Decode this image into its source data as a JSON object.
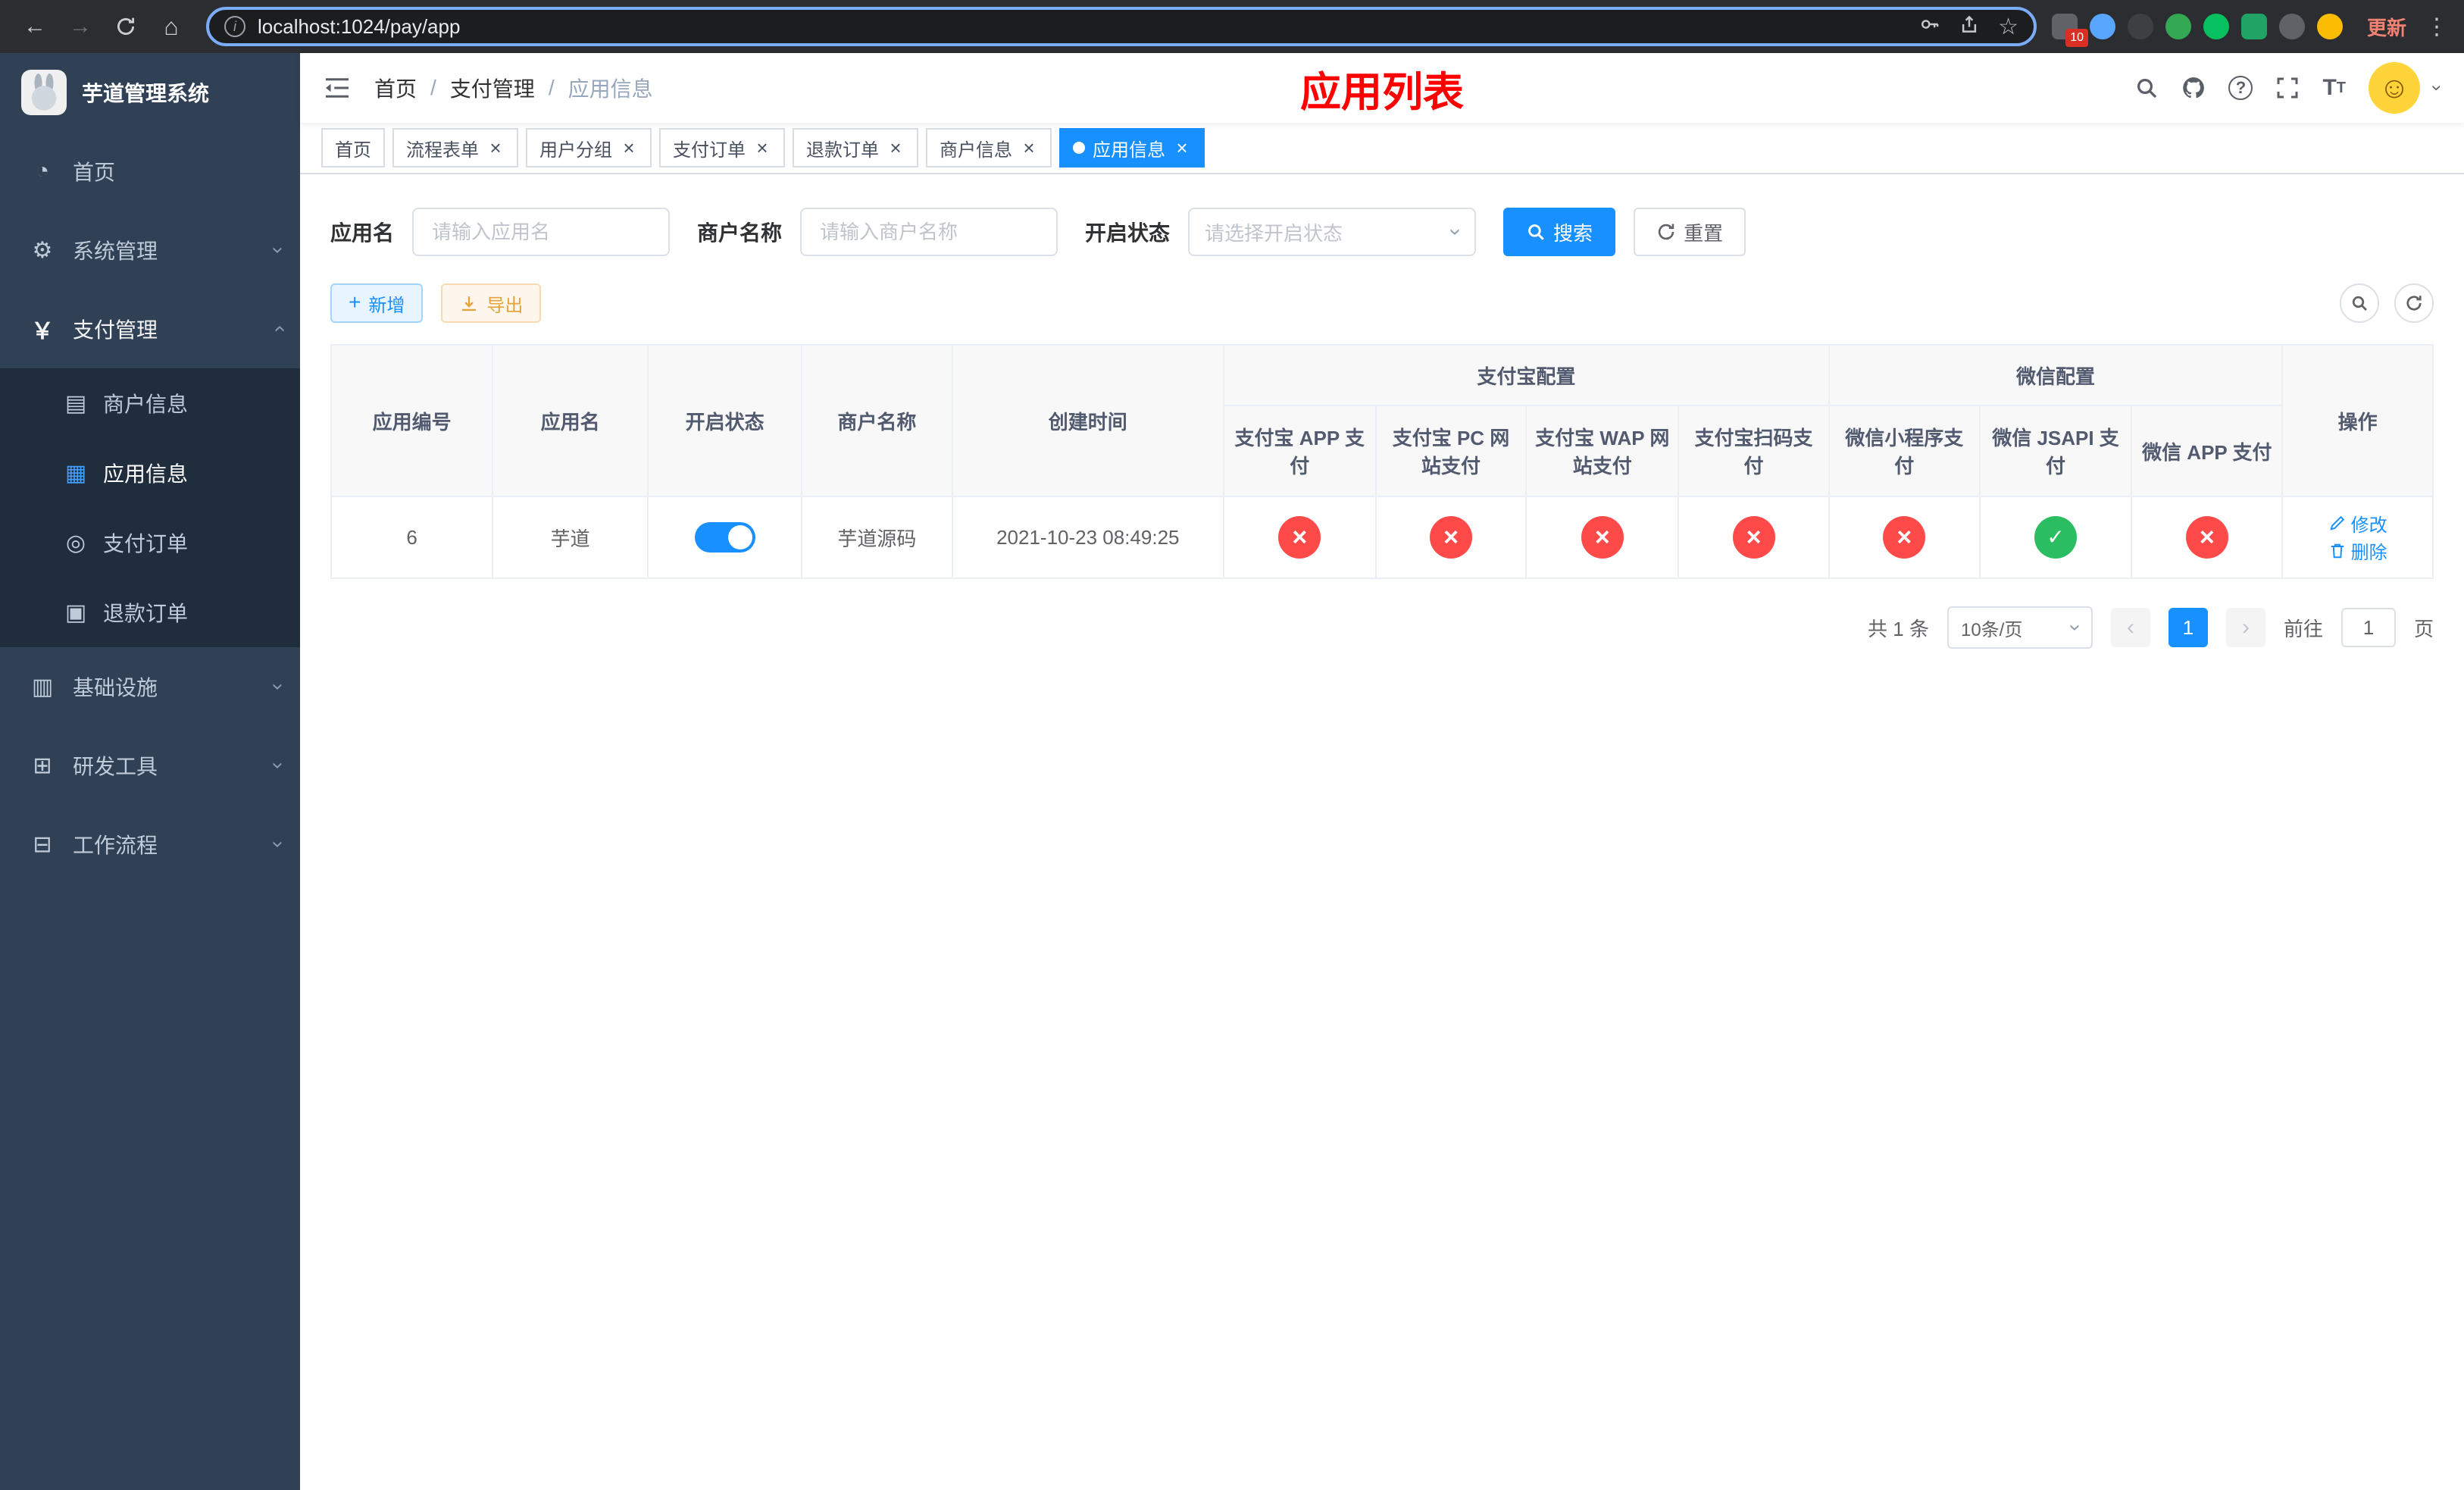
{
  "colors": {
    "primary": "#1890ff",
    "success": "#2abd62",
    "danger": "#ff4a4a",
    "warning": "#e6a23c",
    "title_red": "#ff0000",
    "sidebar_bg": "#304156",
    "submenu_bg": "#1f2d3d"
  },
  "browser": {
    "url": "localhost:1024/pay/app",
    "update_label": "更新",
    "extension_badge": "10"
  },
  "sidebar": {
    "title": "芋道管理系统",
    "menu": [
      {
        "label": "首页",
        "icon": "dashboard-icon"
      },
      {
        "label": "系统管理",
        "icon": "gear-icon"
      },
      {
        "label": "支付管理",
        "icon": "yen-icon"
      },
      {
        "label": "基础设施",
        "icon": "infrastructure-icon"
      },
      {
        "label": "研发工具",
        "icon": "tools-icon"
      },
      {
        "label": "工作流程",
        "icon": "workflow-icon"
      }
    ],
    "submenu": [
      {
        "label": "商户信息",
        "icon": "merchant-icon"
      },
      {
        "label": "应用信息",
        "icon": "app-icon"
      },
      {
        "label": "支付订单",
        "icon": "order-icon"
      },
      {
        "label": "退款订单",
        "icon": "refund-icon"
      }
    ]
  },
  "navbar": {
    "breadcrumb": [
      "首页",
      "支付管理",
      "应用信息"
    ],
    "separator": "/",
    "title": "应用列表"
  },
  "tabs": [
    {
      "label": "首页",
      "closable": false,
      "active": false
    },
    {
      "label": "流程表单",
      "closable": true,
      "active": false
    },
    {
      "label": "用户分组",
      "closable": true,
      "active": false
    },
    {
      "label": "支付订单",
      "closable": true,
      "active": false
    },
    {
      "label": "退款订单",
      "closable": true,
      "active": false
    },
    {
      "label": "商户信息",
      "closable": true,
      "active": false
    },
    {
      "label": "应用信息",
      "closable": true,
      "active": true
    }
  ],
  "filters": {
    "app_name_label": "应用名",
    "app_name_placeholder": "请输入应用名",
    "merchant_label": "商户名称",
    "merchant_placeholder": "请输入商户名称",
    "status_label": "开启状态",
    "status_placeholder": "请选择开启状态",
    "search_label": "搜索",
    "reset_label": "重置"
  },
  "toolbar": {
    "add_label": "新增",
    "export_label": "导出"
  },
  "table": {
    "columns": [
      "应用编号",
      "应用名",
      "开启状态",
      "商户名称",
      "创建时间"
    ],
    "group_alipay": "支付宝配置",
    "group_wechat": "微信配置",
    "config_columns": [
      "支付宝 APP 支付",
      "支付宝 PC 网站支付",
      "支付宝 WAP 网站支付",
      "支付宝扫码支付",
      "微信小程序支付",
      "微信 JSAPI 支付",
      "微信 APP 支付"
    ],
    "actions_column": "操作",
    "rows": [
      {
        "id": "6",
        "name": "芋道",
        "status": "on",
        "merchant": "芋道源码",
        "created": "2021-10-23 08:49:25",
        "configs": [
          "disabled",
          "disabled",
          "disabled",
          "disabled",
          "disabled",
          "enabled",
          "disabled"
        ],
        "edit_label": "修改",
        "delete_label": "删除"
      }
    ]
  },
  "pagination": {
    "total": "共 1 条",
    "page_size": "10条/页",
    "page": "1",
    "goto_prefix": "前往",
    "goto_value": "1",
    "goto_suffix": "页"
  }
}
